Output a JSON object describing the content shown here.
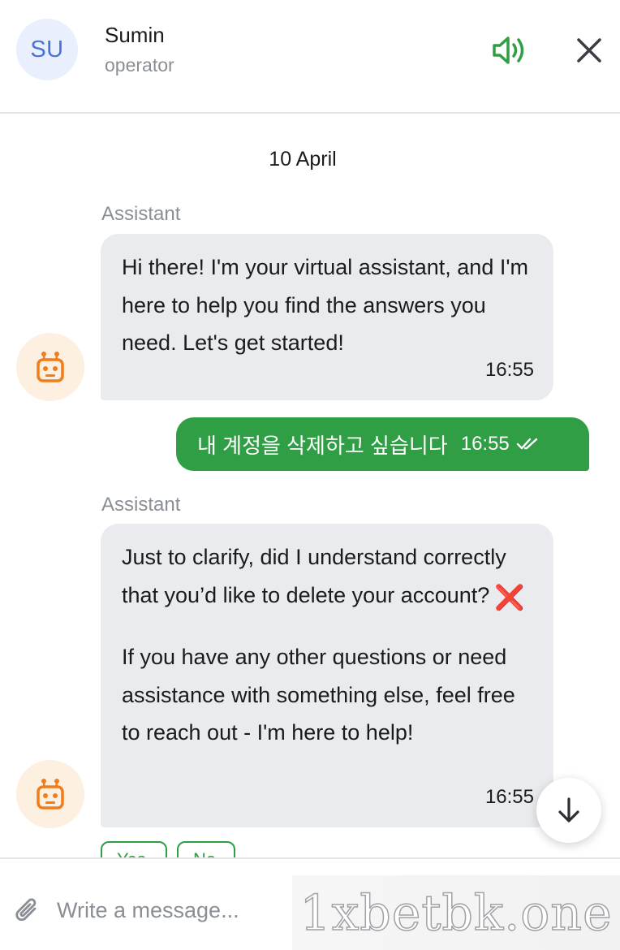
{
  "header": {
    "avatar_initials": "SU",
    "operator_name": "Sumin",
    "operator_role": "operator",
    "sound_icon": "speaker-icon",
    "close_icon": "close-icon"
  },
  "chat": {
    "date": "10 April",
    "messages": [
      {
        "sender": "Assistant",
        "direction": "incoming",
        "paragraphs": [
          "Hi there! I'm your virtual assistant, and I'm here to help you find the answers you need. Let's get started!"
        ],
        "time": "16:55"
      },
      {
        "direction": "outgoing",
        "text": "내 계정을 삭제하고 싶습니다",
        "time": "16:55",
        "status_icon": "double-check-icon"
      },
      {
        "sender": "Assistant",
        "direction": "incoming",
        "paragraphs": [
          "Just to clarify, did I understand correctly that you’d like to delete your account?",
          "If you have any other questions or need assistance with something else, feel free to reach out - I'm here to help!"
        ],
        "emoji": "❌",
        "time": "16:55"
      }
    ],
    "quick_replies": [
      "Yes",
      "No"
    ]
  },
  "composer": {
    "placeholder": "Write a message...",
    "attach_icon": "paperclip-icon"
  },
  "watermark": "1xbetbk.one",
  "colors": {
    "accent_green": "#2f9e44",
    "incoming_bubble": "#e9ebee",
    "avatar_bg": "#e9effc",
    "avatar_text": "#4a72d6",
    "bot_avatar_bg": "#fdf0e0",
    "bot_icon": "#f07d1c"
  }
}
